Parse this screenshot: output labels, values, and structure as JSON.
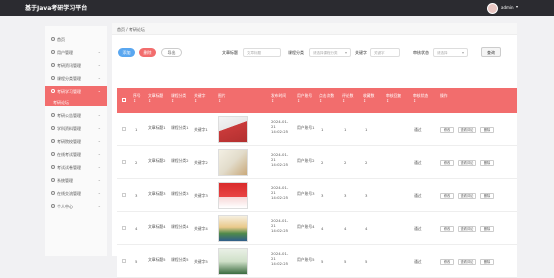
{
  "header": {
    "title": "基于Java考研学习平台",
    "user_name": "admin",
    "caret": "▾"
  },
  "sidebar": {
    "items": [
      {
        "label": "首页"
      },
      {
        "label": "用户管理"
      },
      {
        "label": "考研资讯管理"
      },
      {
        "label": "课程分类管理"
      },
      {
        "label": "考研学习管理"
      },
      {
        "label": "考研公告管理"
      },
      {
        "label": "学科资料管理"
      },
      {
        "label": "考研院校管理"
      },
      {
        "label": "在线考试管理"
      },
      {
        "label": "考试试卷管理"
      },
      {
        "label": "系统管理"
      },
      {
        "label": "在线交流管理"
      },
      {
        "label": "个人中心"
      }
    ],
    "active_sub": "考研论坛",
    "chevron": "⌄"
  },
  "breadcrumb": "首页 / 考研论坛",
  "toolbar": {
    "add": "添加",
    "delete": "删除",
    "export": "导出"
  },
  "filters": {
    "title_label": "文章标题",
    "title_placeholder": "文章标题",
    "category_label": "课程分类",
    "category_placeholder": "请选择课程分类",
    "keyword_label": "关键字",
    "keyword_placeholder": "关键字",
    "status_label": "审核状态",
    "status_placeholder": "请选择",
    "search": "查询"
  },
  "table": {
    "headers": [
      "序号",
      "文章标题",
      "课程分类",
      "关键字",
      "图片",
      "发布时间",
      "用户账号",
      "点击次数",
      "评论数",
      "收藏数",
      "审核回复",
      "审核状态",
      "操作"
    ],
    "sort_mark": "↕",
    "rows": [
      {
        "no": "1",
        "title": "文章标题1",
        "category": "课程分类1",
        "keyword": "关键字1",
        "time": "2024-01-21 14:02:25",
        "user": "用户账号1",
        "clicks": "1",
        "comments": "1",
        "favorites": "1",
        "status": "通过"
      },
      {
        "no": "2",
        "title": "文章标题2",
        "category": "课程分类2",
        "keyword": "关键字2",
        "time": "2024-01-21 14:02:25",
        "user": "用户账号2",
        "clicks": "2",
        "comments": "2",
        "favorites": "2",
        "status": "通过"
      },
      {
        "no": "3",
        "title": "文章标题3",
        "category": "课程分类3",
        "keyword": "关键字3",
        "time": "2024-01-21 14:02:25",
        "user": "用户账号3",
        "clicks": "3",
        "comments": "3",
        "favorites": "3",
        "status": "通过"
      },
      {
        "no": "4",
        "title": "文章标题4",
        "category": "课程分类4",
        "keyword": "关键字4",
        "time": "2024-01-21 14:02:25",
        "user": "用户账号4",
        "clicks": "4",
        "comments": "4",
        "favorites": "4",
        "status": "通过"
      },
      {
        "no": "5",
        "title": "文章标题5",
        "category": "课程分类5",
        "keyword": "关键字5",
        "time": "2024-01-21 14:02:25",
        "user": "用户账号5",
        "clicks": "5",
        "comments": "5",
        "favorites": "5",
        "status": "通过"
      }
    ],
    "actions": {
      "edit": "修改",
      "comments": "查看评论",
      "delete": "删除"
    }
  },
  "colors": {
    "accent": "#f26d6d",
    "topbar": "#2b2b30",
    "add_button": "#5aa7f0"
  }
}
